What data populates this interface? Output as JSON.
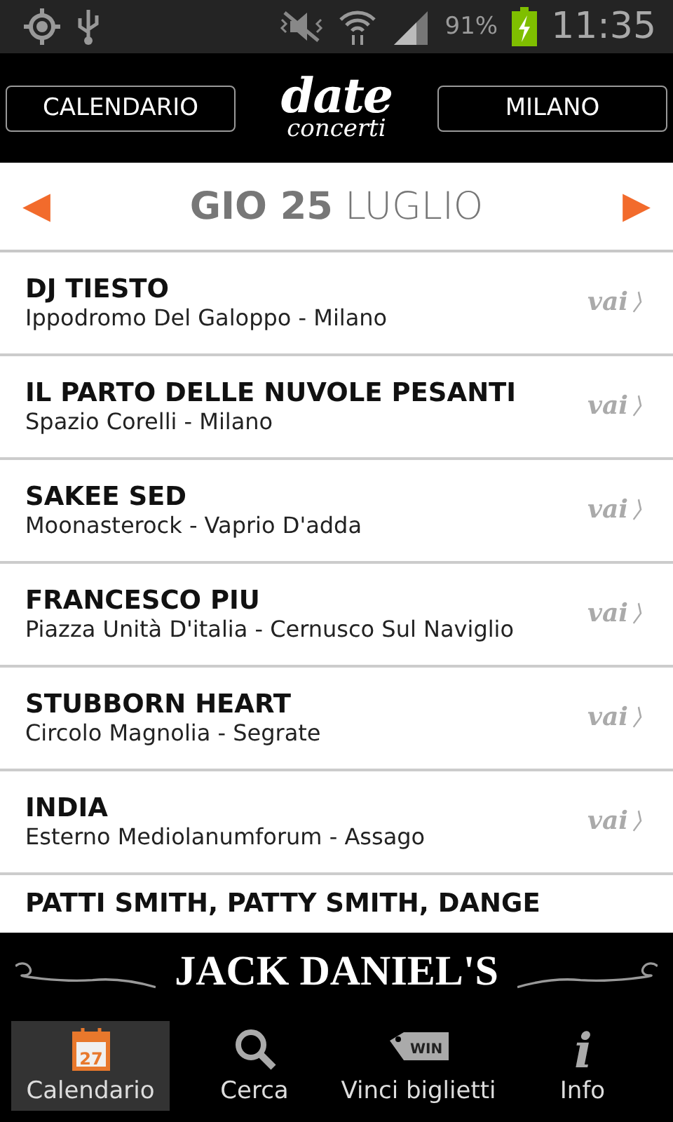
{
  "status_bar": {
    "battery": "91%",
    "time": "11:35"
  },
  "header": {
    "left_button": "CALENDARIO",
    "logo_top": "date",
    "logo_bottom": "concerti",
    "right_button": "MILANO"
  },
  "date_bar": {
    "prev": "◀",
    "date": "**GIO 25** LUGLIO",
    "next": "▶"
  },
  "events": [
    {
      "title": "DJ TIESTO",
      "place": "Ippodromo Del Galoppo - Milano",
      "link": "vai",
      "chevron": "〉"
    },
    {
      "title": "IL PARTO DELLE NUVOLE PESANTI",
      "place": "Spazio Corelli - Milano",
      "link": "vai",
      "chevron": "〉"
    },
    {
      "title": "SAKEE SED",
      "place": "Moonasterock - Vaprio D'adda",
      "link": "vai",
      "chevron": "〉"
    },
    {
      "title": "FRANCESCO PIU",
      "place": "Piazza Unità D'italia - Cernusco Sul Naviglio",
      "link": "vai",
      "chevron": "〉"
    },
    {
      "title": "STUBBORN HEART",
      "place": "Circolo Magnolia - Segrate",
      "link": "vai",
      "chevron": "〉"
    },
    {
      "title": "INDIA",
      "place": "Esterno Mediolanumforum - Assago",
      "link": "vai",
      "chevron": "〉"
    },
    {
      "title": "PATTI SMITH, PATTY SMITH, DANGE"
    }
  ],
  "banner": {
    "text": "JACK DANIEL'S"
  },
  "tabs": [
    {
      "kind": "calendar",
      "icon_text": "27",
      "label": "Calendario",
      "selected": true
    },
    {
      "kind": "search",
      "label": "Cerca",
      "selected": false
    },
    {
      "kind": "tag",
      "icon_text": "WIN",
      "label": "Vinci biglietti",
      "selected": false
    },
    {
      "kind": "info",
      "icon_text": "i",
      "label": "Info",
      "selected": false
    }
  ]
}
